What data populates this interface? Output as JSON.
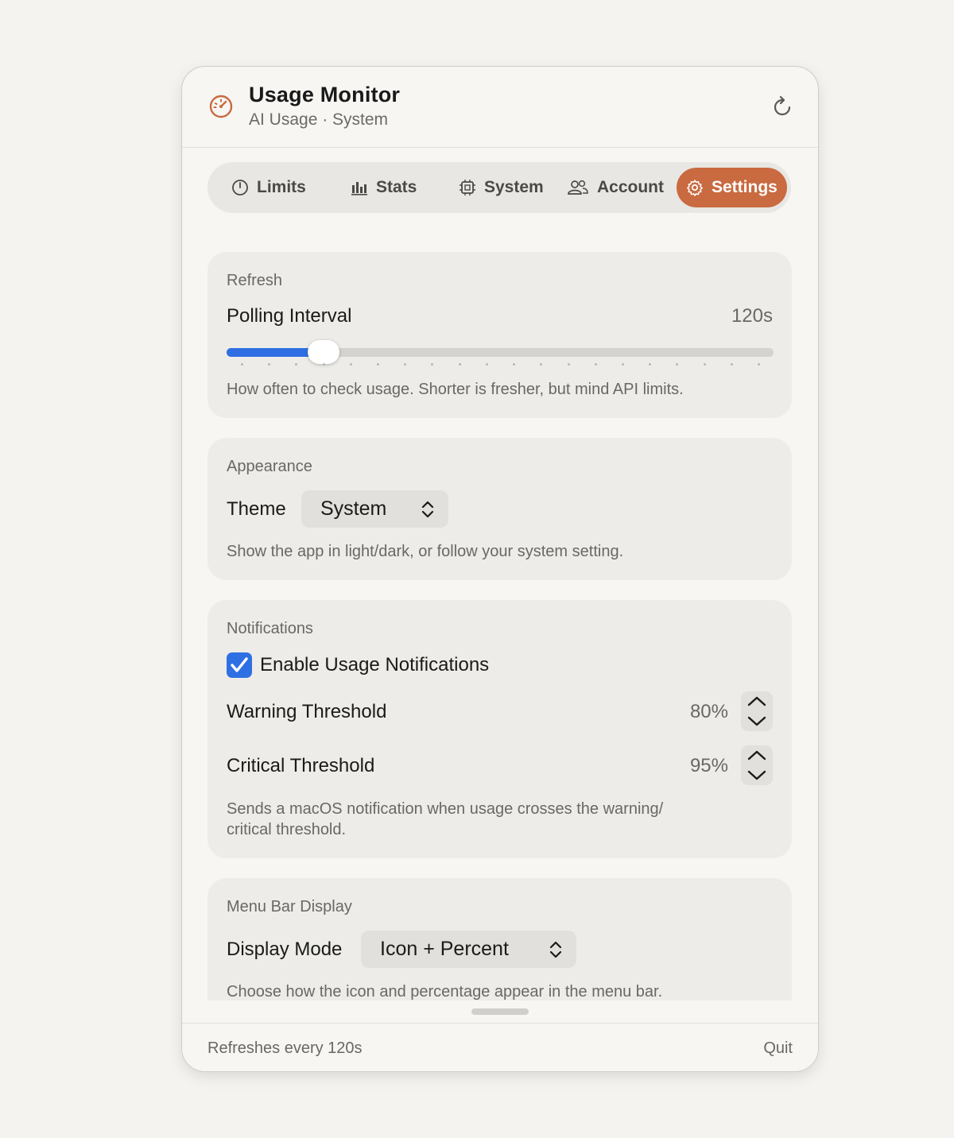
{
  "header": {
    "title": "Usage Monitor",
    "subtitle": "AI Usage · System",
    "refresh_icon": "refresh-icon",
    "app_icon": "gauge-icon"
  },
  "tabs": [
    {
      "label": "Limits",
      "icon": "gauge-icon",
      "active": false
    },
    {
      "label": "Stats",
      "icon": "bar-chart-icon",
      "active": false
    },
    {
      "label": "System",
      "icon": "cpu-icon",
      "active": false
    },
    {
      "label": "Account",
      "icon": "people-icon",
      "active": false
    },
    {
      "label": "Settings",
      "icon": "gear-icon",
      "active": true
    }
  ],
  "refresh": {
    "section": "Refresh",
    "label": "Polling Interval",
    "value": "120s",
    "slider_fraction": 0.177,
    "help": "How often to check usage. Shorter is fresher, but mind API limits."
  },
  "appearance": {
    "section": "Appearance",
    "theme_label": "Theme",
    "theme_value": "System",
    "help": "Show the app in light/dark, or follow your system setting."
  },
  "notifications": {
    "section": "Notifications",
    "enable_label": "Enable Usage Notifications",
    "enabled": true,
    "warning_label": "Warning Threshold",
    "warning_value": "80%",
    "critical_label": "Critical Threshold",
    "critical_value": "95%",
    "help_line1": "Sends a macOS notification when usage crosses the warning/",
    "help_line2": "critical threshold."
  },
  "menubar": {
    "section": "Menu Bar Display",
    "mode_label": "Display Mode",
    "mode_value": "Icon + Percent",
    "help": "Choose how the icon and percentage appear in the menu bar."
  },
  "footer": {
    "status": "Refreshes every 120s",
    "quit": "Quit"
  },
  "colors": {
    "accent": "#c96a40",
    "blue": "#2f6fe4"
  }
}
